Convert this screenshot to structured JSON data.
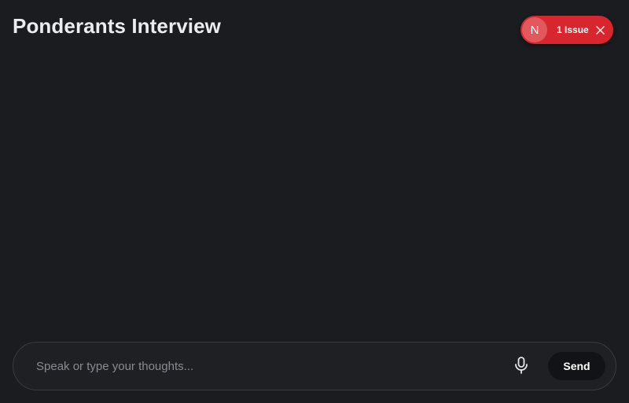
{
  "header": {
    "title": "Ponderants Interview"
  },
  "issue_indicator": {
    "logo_letter": "N",
    "label": "1 Issue",
    "color": "#d7262e",
    "logo_icon": "nextjs-logo-icon",
    "close_icon": "close-icon"
  },
  "composer": {
    "placeholder": "Speak or type your thoughts...",
    "value": "",
    "mic_icon": "microphone-icon",
    "send_label": "Send"
  },
  "theme": {
    "background": "#1b1c20",
    "accent_error": "#d7262e"
  }
}
